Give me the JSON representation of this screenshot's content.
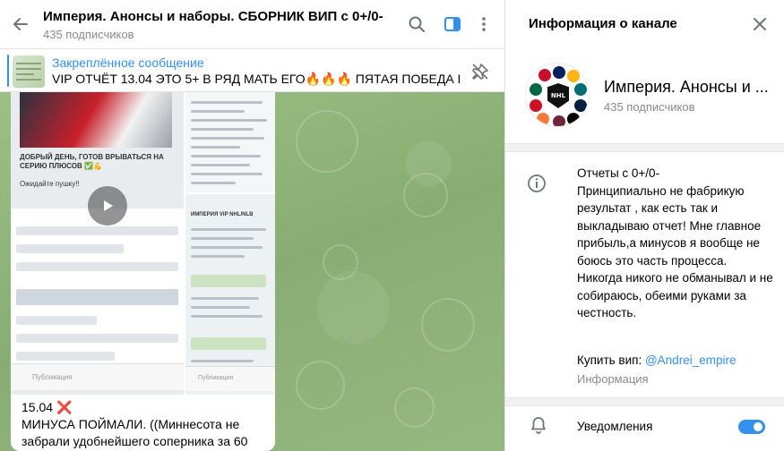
{
  "header": {
    "title": "Империя. Анонсы и наборы. СБОРНИК ВИП с 0+/0-",
    "subscribers": "435 подписчиков"
  },
  "pinned": {
    "label": "Закреплённое сообщение",
    "text": "VIP ОТЧЁТ 13.04 ЭТО 5+ В РЯД МАТЬ ЕГО🔥🔥🔥 ПЯТАЯ ПОБЕДА ПО..."
  },
  "message": {
    "shot_caption": "ДОБРЫЙ ДЕНЬ, ГОТОВ ВРЫВАТЬСЯ НА СЕРИЮ ПЛЮСОВ ✅💪",
    "shot_sub": "Ожидайте пушку!!",
    "shot_right_title": "ИМПЕРИЯ VIP NHL/NLB",
    "type_placeholder": "Публикация",
    "date": "15.04",
    "cross": "❌",
    "line2": "МИНУСА ПОЙМАЛИ. ((Миннесота не",
    "line3": "забрали удобнейшего соперника за 60"
  },
  "side": {
    "title": "Информация о канале",
    "channel_name": "Империя. Анонсы и ...",
    "subscribers": "435 подписчиков",
    "description": [
      "Отчеты с 0+/0-",
      "Принципиально не фабрикую результат , как есть так и выкладываю отчет! Мне главное прибыль,а минусов я вообще не боюсь это часть процесса.",
      "Никогда никого не обманывал и не собираюсь, обеими руками за честность."
    ],
    "buy_prefix": "Купить вип: ",
    "buy_link": "@Andrei_empire",
    "info_caption": "Информация",
    "notifications_label": "Уведомления",
    "notifications_on": true
  },
  "colors": {
    "accent": "#3390ec",
    "chat_bg": "#8fb17a",
    "red": "#e0262c"
  },
  "icons": {
    "back": "arrow-left-icon",
    "search": "search-icon",
    "sidebar": "sidebar-toggle-icon",
    "more": "more-vertical-icon",
    "unpin": "unpin-icon",
    "close": "close-icon",
    "info": "info-icon",
    "bell": "bell-icon",
    "play": "play-icon"
  }
}
